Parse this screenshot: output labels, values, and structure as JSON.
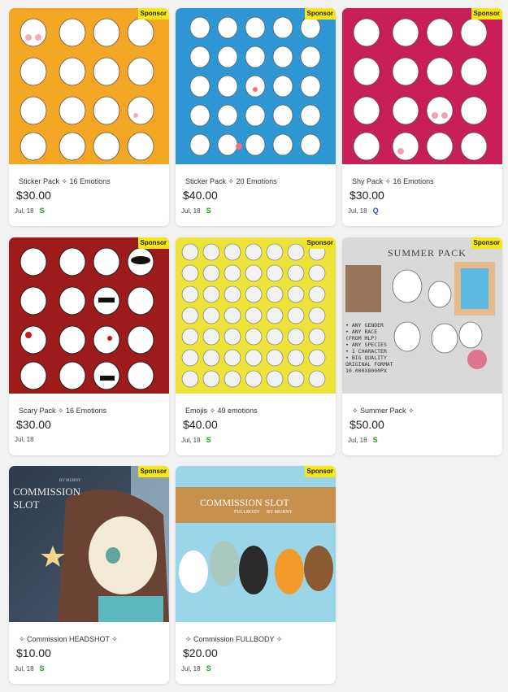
{
  "badge_label": "Sponsor",
  "cards": [
    {
      "title": "Sticker Pack ✧ 16 Emotions",
      "price": "$30.00",
      "date": "Jul, 18",
      "rank": "S",
      "rank_color": "#1aa321",
      "bg": "#f2a624"
    },
    {
      "title": "Sticker Pack ✧ 20 Emotions",
      "price": "$40.00",
      "date": "Jul, 18",
      "rank": "S",
      "rank_color": "#1aa321",
      "bg": "#2e96d2"
    },
    {
      "title": "Shy Pack ✧ 16 Emotions",
      "price": "$30.00",
      "date": "Jul, 18",
      "rank": "Q",
      "rank_color": "#2a4fb8",
      "bg": "#c81e5a"
    },
    {
      "title": "Scary Pack ✧ 16 Emotions",
      "price": "$30.00",
      "date": "Jul, 18",
      "rank": "",
      "rank_color": "#1aa321",
      "bg": "#9e1b1b"
    },
    {
      "title": "Emojis ✧ 49 emotions",
      "price": "$40.00",
      "date": "Jul, 18",
      "rank": "S",
      "rank_color": "#1aa321",
      "bg": "#ece33a"
    },
    {
      "title": "✧ Summer Pack ✧",
      "price": "$50.00",
      "date": "Jul, 18",
      "rank": "S",
      "rank_color": "#1aa321",
      "bg": "#d9d9d9",
      "art_title": "SUMMER PACK",
      "art_lines": [
        "• ANY GENDER",
        "• ANY RACE",
        "(FROM MLP)",
        "• ANY SPECIES",
        "• 1 CHARACTER",
        "• BIG QUALITY",
        "ORIGINAL FORMAT",
        "10.000X8000PX"
      ]
    },
    {
      "title": "✧ Commission HEADSHOT ✧",
      "price": "$10.00",
      "date": "Jul, 18",
      "rank": "S",
      "rank_color": "#1aa321",
      "bg": "#3a4a5e",
      "art_title": "COMMISSION",
      "art_sub": "SLOT",
      "art_by": "BY MURNY"
    },
    {
      "title": "✧ Commission FULLBODY ✧",
      "price": "$20.00",
      "date": "Jul, 18",
      "rank": "S",
      "rank_color": "#1aa321",
      "bg": "#9ad6e8",
      "art_title": "COMMISSION SLOT",
      "art_sub": "FULLBODY",
      "art_by": "BY MURNY"
    }
  ]
}
